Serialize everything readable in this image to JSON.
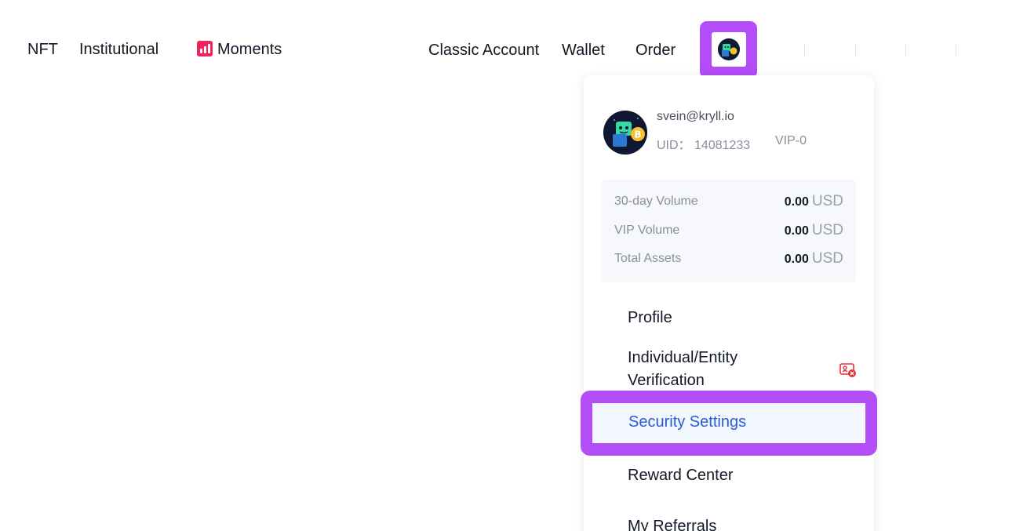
{
  "nav": {
    "left": [
      {
        "label": "NFT"
      },
      {
        "label": "Institutional"
      },
      {
        "label": "Moments",
        "icon": "bar-chart-icon"
      }
    ],
    "right": [
      {
        "label": "Classic Account"
      },
      {
        "label": "Wallet"
      },
      {
        "label": "Order"
      }
    ],
    "avatar_icon": "robot-avatar-icon"
  },
  "account": {
    "email": "svein@kryll.io",
    "uid_label": "UID：",
    "uid": "14081233",
    "vip": "VIP-0"
  },
  "stats": [
    {
      "label": "30-day Volume",
      "value": "0.00",
      "unit": "USD"
    },
    {
      "label": "VIP Volume",
      "value": "0.00",
      "unit": "USD"
    },
    {
      "label": "Total Assets",
      "value": "0.00",
      "unit": "USD"
    }
  ],
  "menu": {
    "profile": "Profile",
    "verification_line1": "Individual/Entity",
    "verification_line2": "Verification",
    "verification_icon": "id-card-error-icon",
    "security": "Security Settings",
    "reward": "Reward Center",
    "referrals": "My Referrals"
  },
  "colors": {
    "highlight": "#b24df7",
    "active_text": "#2c5ad8",
    "active_bg": "#f2f6fd",
    "error": "#e5323f",
    "moments_icon": "#f0245d"
  }
}
